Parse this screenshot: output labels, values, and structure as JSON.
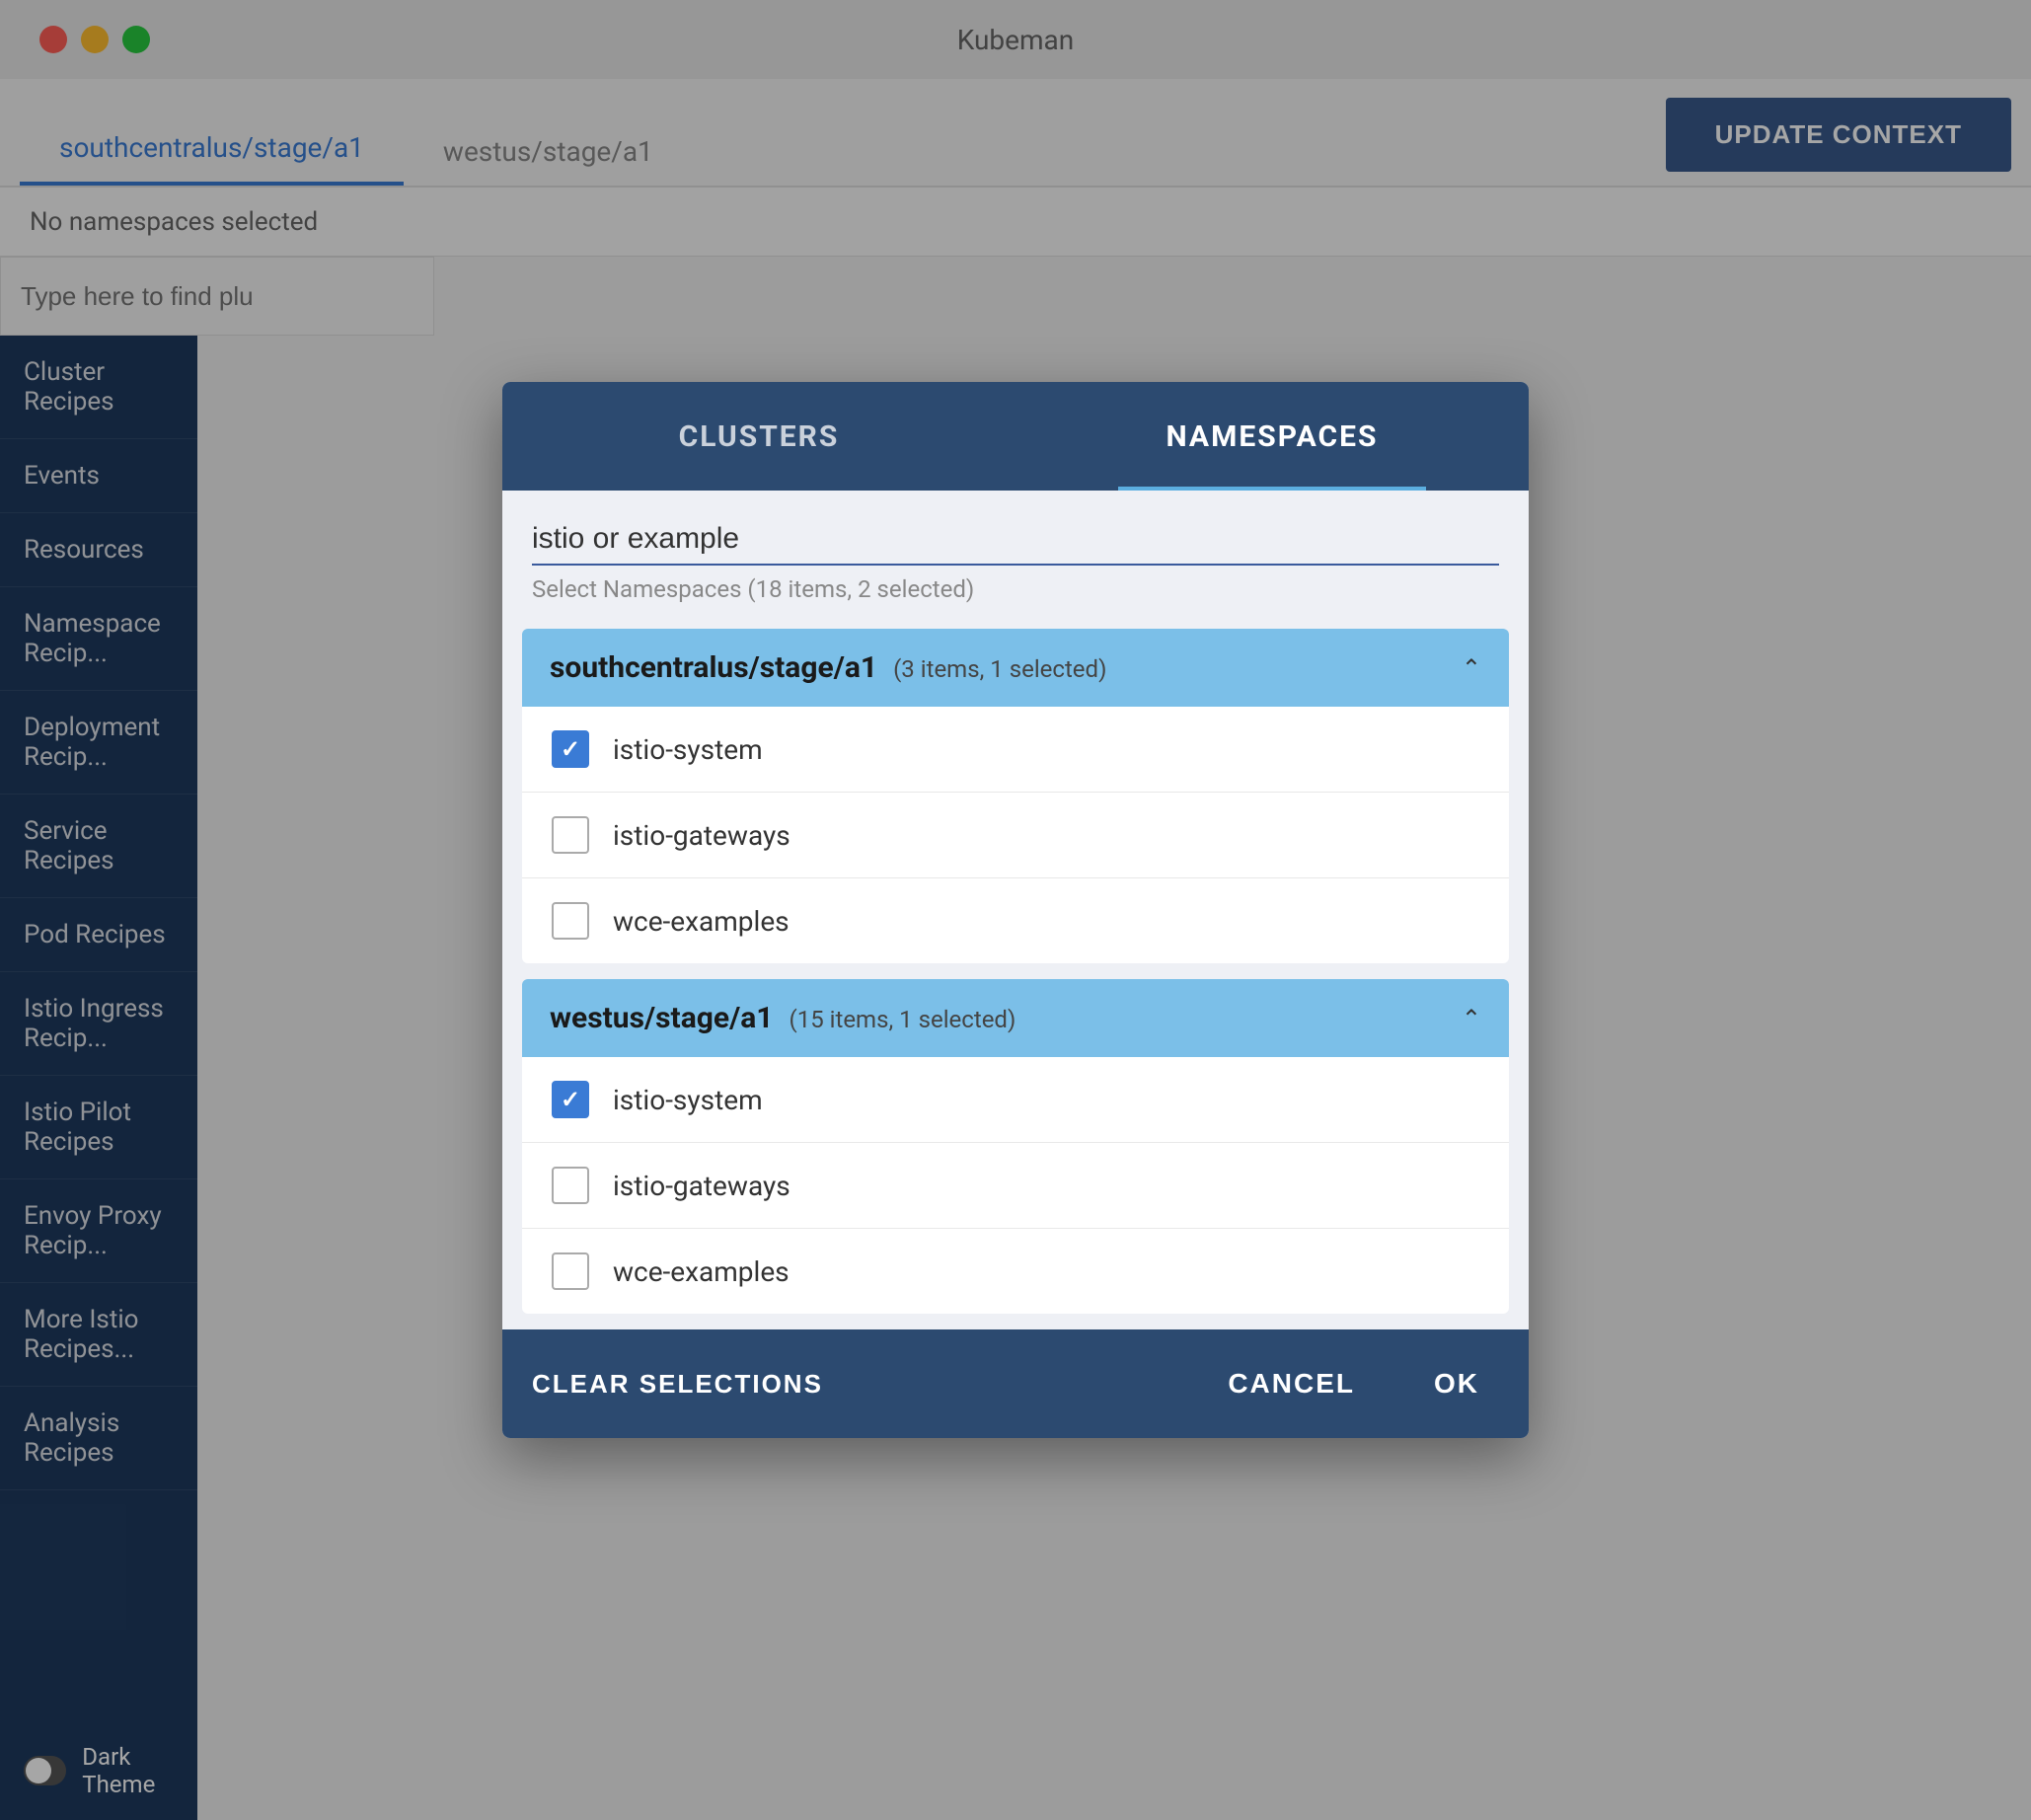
{
  "app": {
    "title": "Kubeman"
  },
  "header": {
    "tab1_label": "southcentralus/stage/a1",
    "tab2_label": "westus/stage/a1",
    "update_button": "UPDATE CONTEXT"
  },
  "no_ns_bar": {
    "text": "No namespaces selected"
  },
  "search": {
    "placeholder": "Type here to find plu"
  },
  "sidebar": {
    "items": [
      {
        "label": "Cluster Recipes"
      },
      {
        "label": "Events"
      },
      {
        "label": "Resources"
      },
      {
        "label": "Namespace Recip..."
      },
      {
        "label": "Deployment Recip..."
      },
      {
        "label": "Service Recipes"
      },
      {
        "label": "Pod Recipes"
      },
      {
        "label": "Istio Ingress Recip..."
      },
      {
        "label": "Istio Pilot Recipes"
      },
      {
        "label": "Envoy Proxy Recip..."
      },
      {
        "label": "More Istio Recipes..."
      },
      {
        "label": "Analysis Recipes"
      }
    ]
  },
  "dark_theme": {
    "label": "Dark Theme"
  },
  "modal": {
    "tab_clusters": "CLUSTERS",
    "tab_namespaces": "NAMESPACES",
    "search_value": "istio or example",
    "select_info": "Select Namespaces (18 items, 2 selected)",
    "cluster1": {
      "name": "southcentralus/stage/a1",
      "count": "(3 items, 1 selected)",
      "items": [
        {
          "label": "istio-system",
          "checked": true
        },
        {
          "label": "istio-gateways",
          "checked": false
        },
        {
          "label": "wce-examples",
          "checked": false
        }
      ]
    },
    "cluster2": {
      "name": "westus/stage/a1",
      "count": "(15 items, 1 selected)",
      "items": [
        {
          "label": "istio-system",
          "checked": true
        },
        {
          "label": "istio-gateways",
          "checked": false
        },
        {
          "label": "wce-examples",
          "checked": false
        }
      ]
    },
    "footer": {
      "clear_label": "CLEAR SELECTIONS",
      "cancel_label": "CANCEL",
      "ok_label": "OK"
    }
  }
}
